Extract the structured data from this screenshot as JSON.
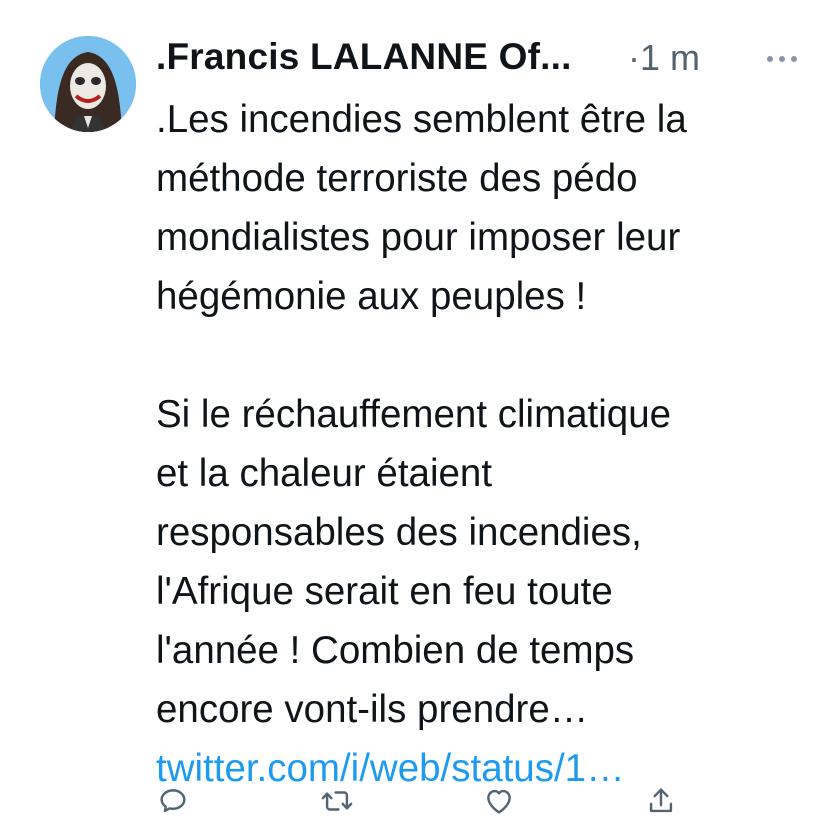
{
  "tweet": {
    "author_name": ".Francis LALANNE Of...",
    "timestamp": "·1 m",
    "text_lines_p1": [
      ".Les incendies semblent être la",
      "méthode terroriste des pédo",
      "mondialistes pour imposer leur",
      "hégémonie aux peuples !"
    ],
    "text_lines_p2": [
      "Si le réchauffement climatique",
      "et la chaleur étaient",
      "responsables des incendies,",
      "l'Afrique serait en feu toute",
      "l'année ! Combien de temps",
      "encore vont-ils prendre…"
    ],
    "link": "twitter.com/i/web/status/1…"
  },
  "icons": {
    "avatar": "profile-photo",
    "more": "more-options-icon",
    "reply": "reply-icon",
    "retweet": "retweet-icon",
    "like": "heart-icon",
    "share": "share-icon"
  },
  "colors": {
    "text": "#0f1419",
    "secondary": "#536471",
    "link": "#1d9bf0",
    "background": "#ffffff"
  }
}
